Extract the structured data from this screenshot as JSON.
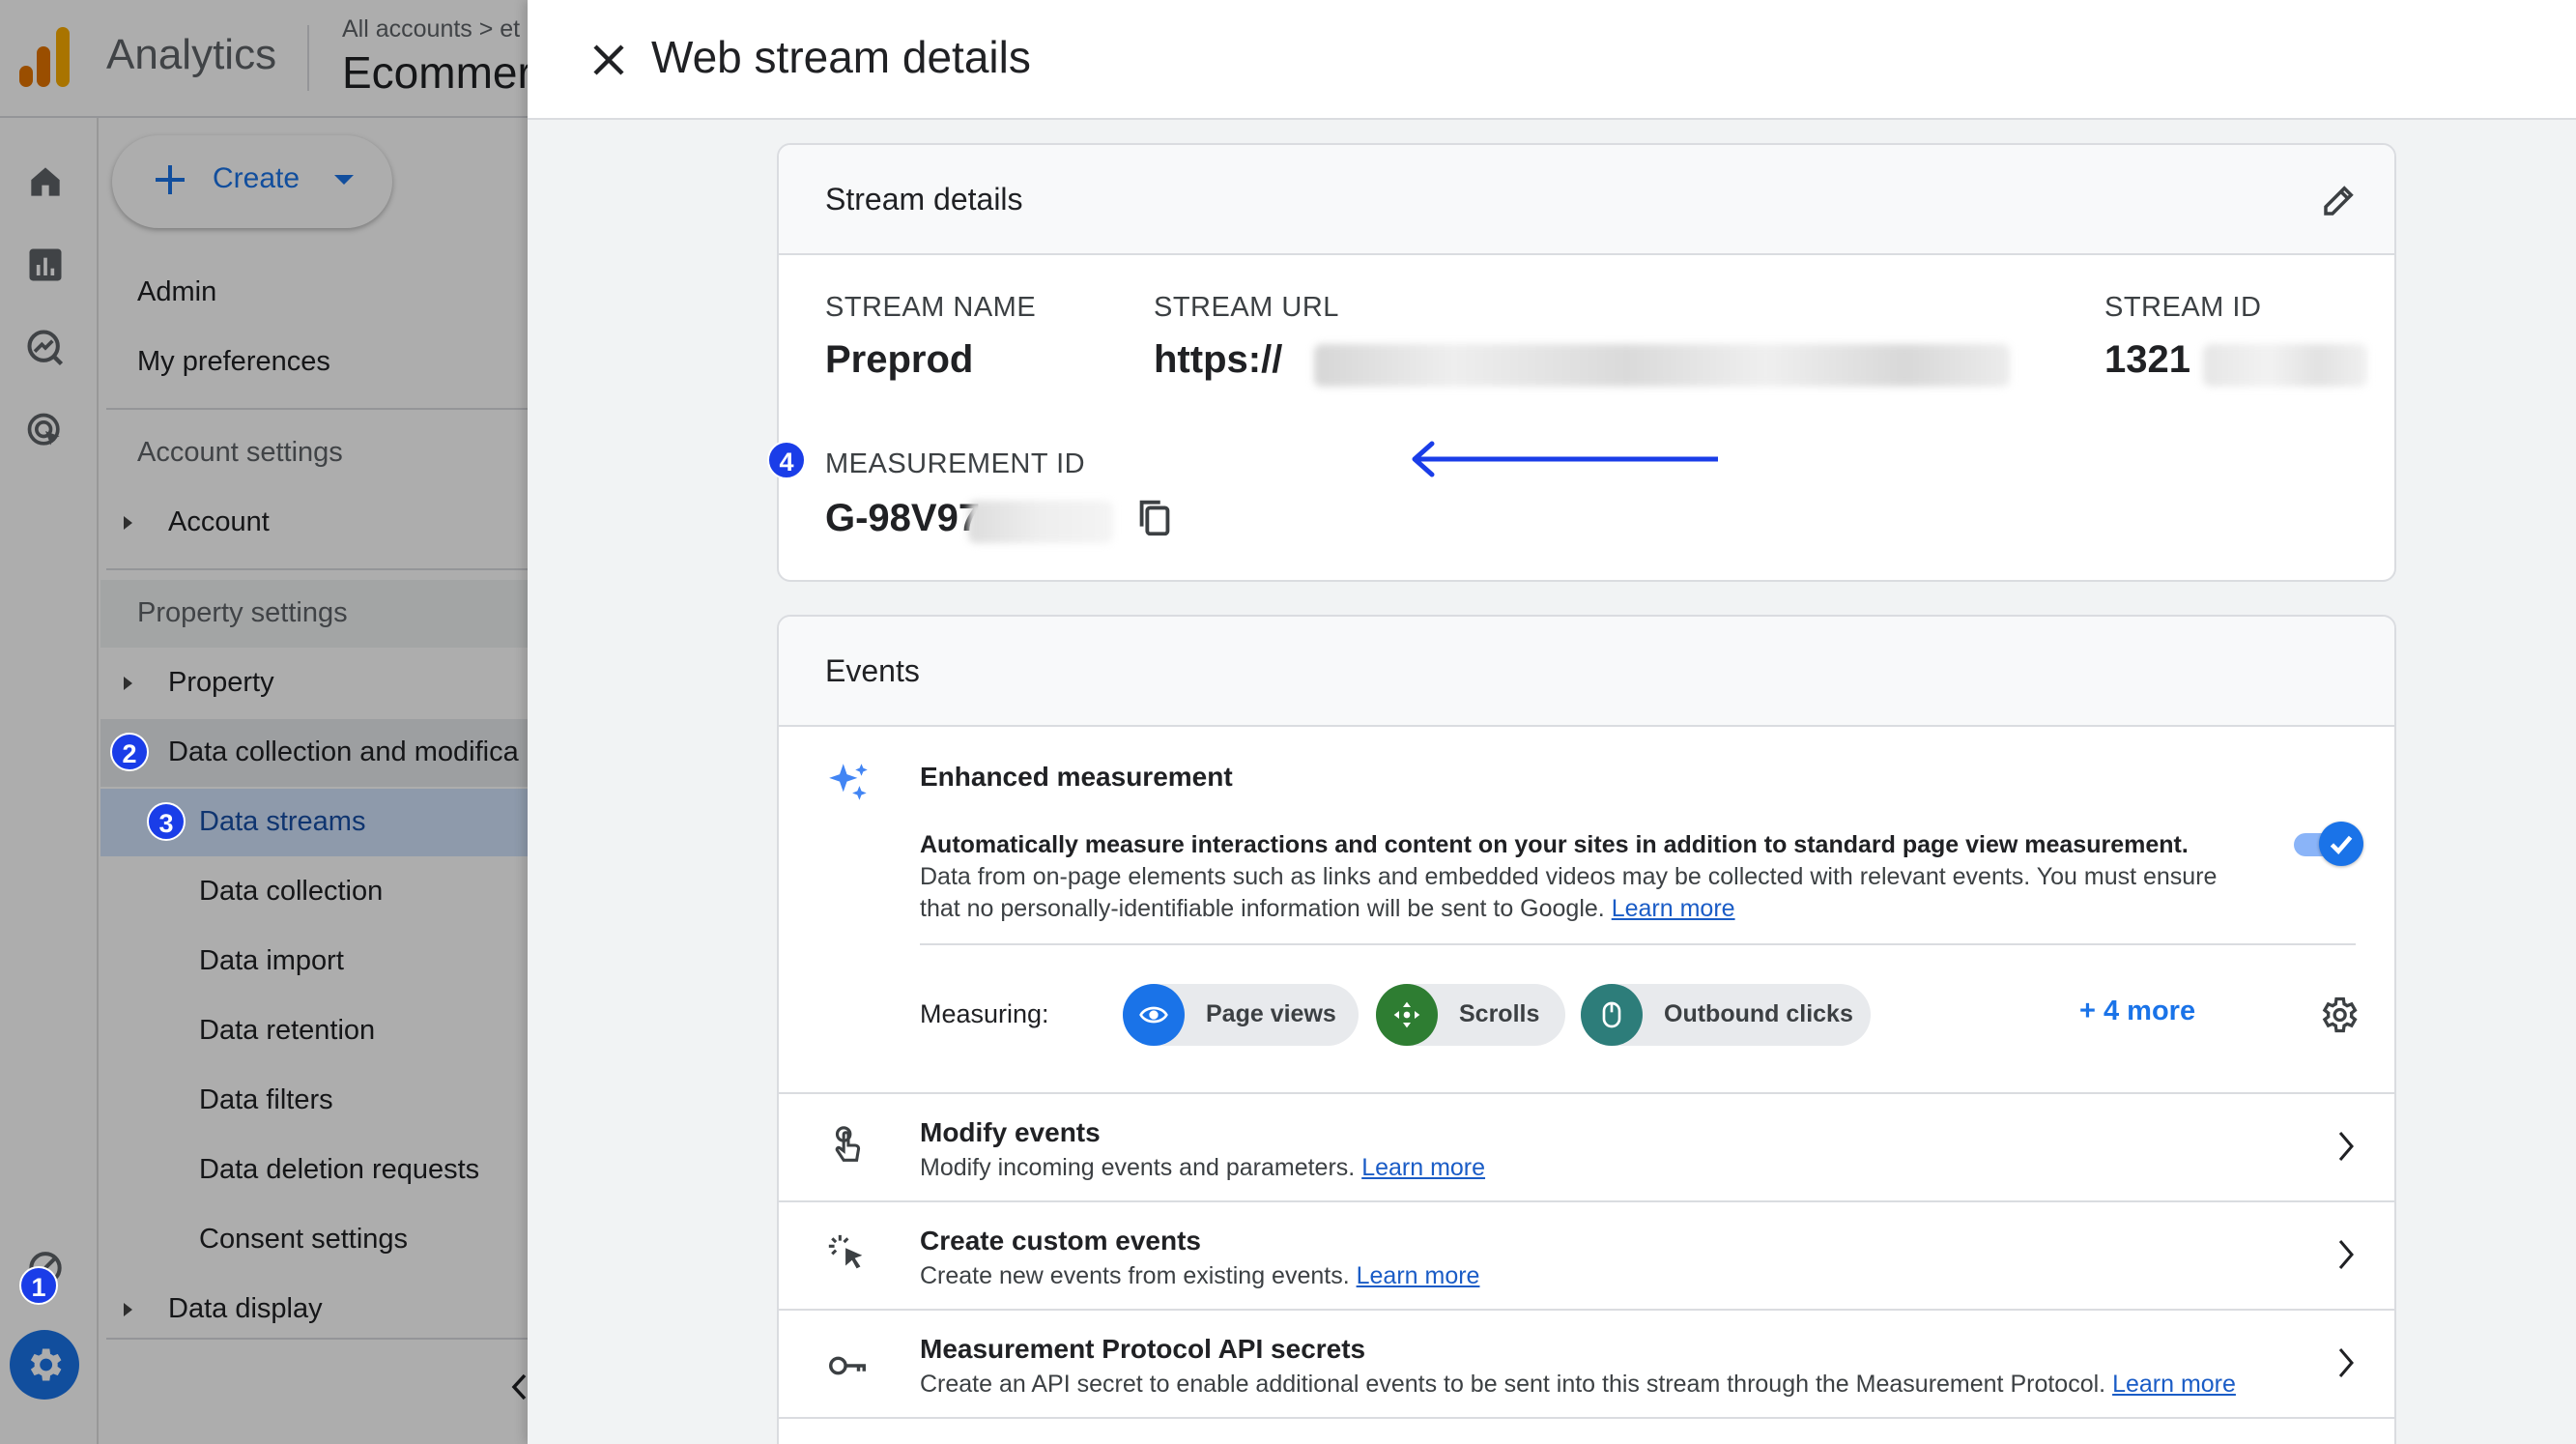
{
  "app": {
    "name": "Analytics",
    "breadcrumb": "All accounts > et",
    "property": "Ecommer"
  },
  "nav": {
    "create_label": "Create",
    "admin": "Admin",
    "my_preferences": "My preferences",
    "account_settings": "Account settings",
    "account": "Account",
    "property_settings": "Property settings",
    "property": "Property",
    "data_collection_modification": "Data collection and modifica",
    "data_streams": "Data streams",
    "data_collection": "Data collection",
    "data_import": "Data import",
    "data_retention": "Data retention",
    "data_filters": "Data filters",
    "data_deletion_requests": "Data deletion requests",
    "consent_settings": "Consent settings",
    "data_display": "Data display"
  },
  "steps": {
    "one": "1",
    "two": "2",
    "three": "3",
    "four": "4"
  },
  "panel": {
    "title": "Web stream details"
  },
  "stream_details": {
    "title": "Stream details",
    "stream_name_label": "STREAM NAME",
    "stream_name": "Preprod",
    "stream_url_label": "STREAM URL",
    "stream_url": "https://",
    "stream_id_label": "STREAM ID",
    "stream_id": "1321",
    "measurement_id_label": "MEASUREMENT ID",
    "measurement_id": "G-98V97"
  },
  "events": {
    "title": "Events",
    "enhanced": {
      "title": "Enhanced measurement",
      "desc_bold": "Automatically measure interactions and content on your sites in addition to standard page view measurement.",
      "desc": "Data from on-page elements such as links and embedded videos may be collected with relevant events. You must ensure that no personally-identifiable information will be sent to Google.",
      "learn_more": "Learn more",
      "measuring_label": "Measuring:",
      "chips": [
        "Page views",
        "Scrolls",
        "Outbound clicks"
      ],
      "more": "+ 4 more"
    },
    "rows": [
      {
        "title": "Modify events",
        "desc": "Modify incoming events and parameters.",
        "link": "Learn more"
      },
      {
        "title": "Create custom events",
        "desc": "Create new events from existing events.",
        "link": "Learn more"
      },
      {
        "title": "Measurement Protocol API secrets",
        "desc": "Create an API secret to enable additional events to be sent into this stream through the Measurement Protocol.",
        "link": "Learn more"
      }
    ]
  },
  "colors": {
    "accent": "#1a73e8",
    "step_badge": "#1a3de8",
    "scroll_chip": "#2e7d32",
    "outbound_chip": "#2d7d7a"
  }
}
